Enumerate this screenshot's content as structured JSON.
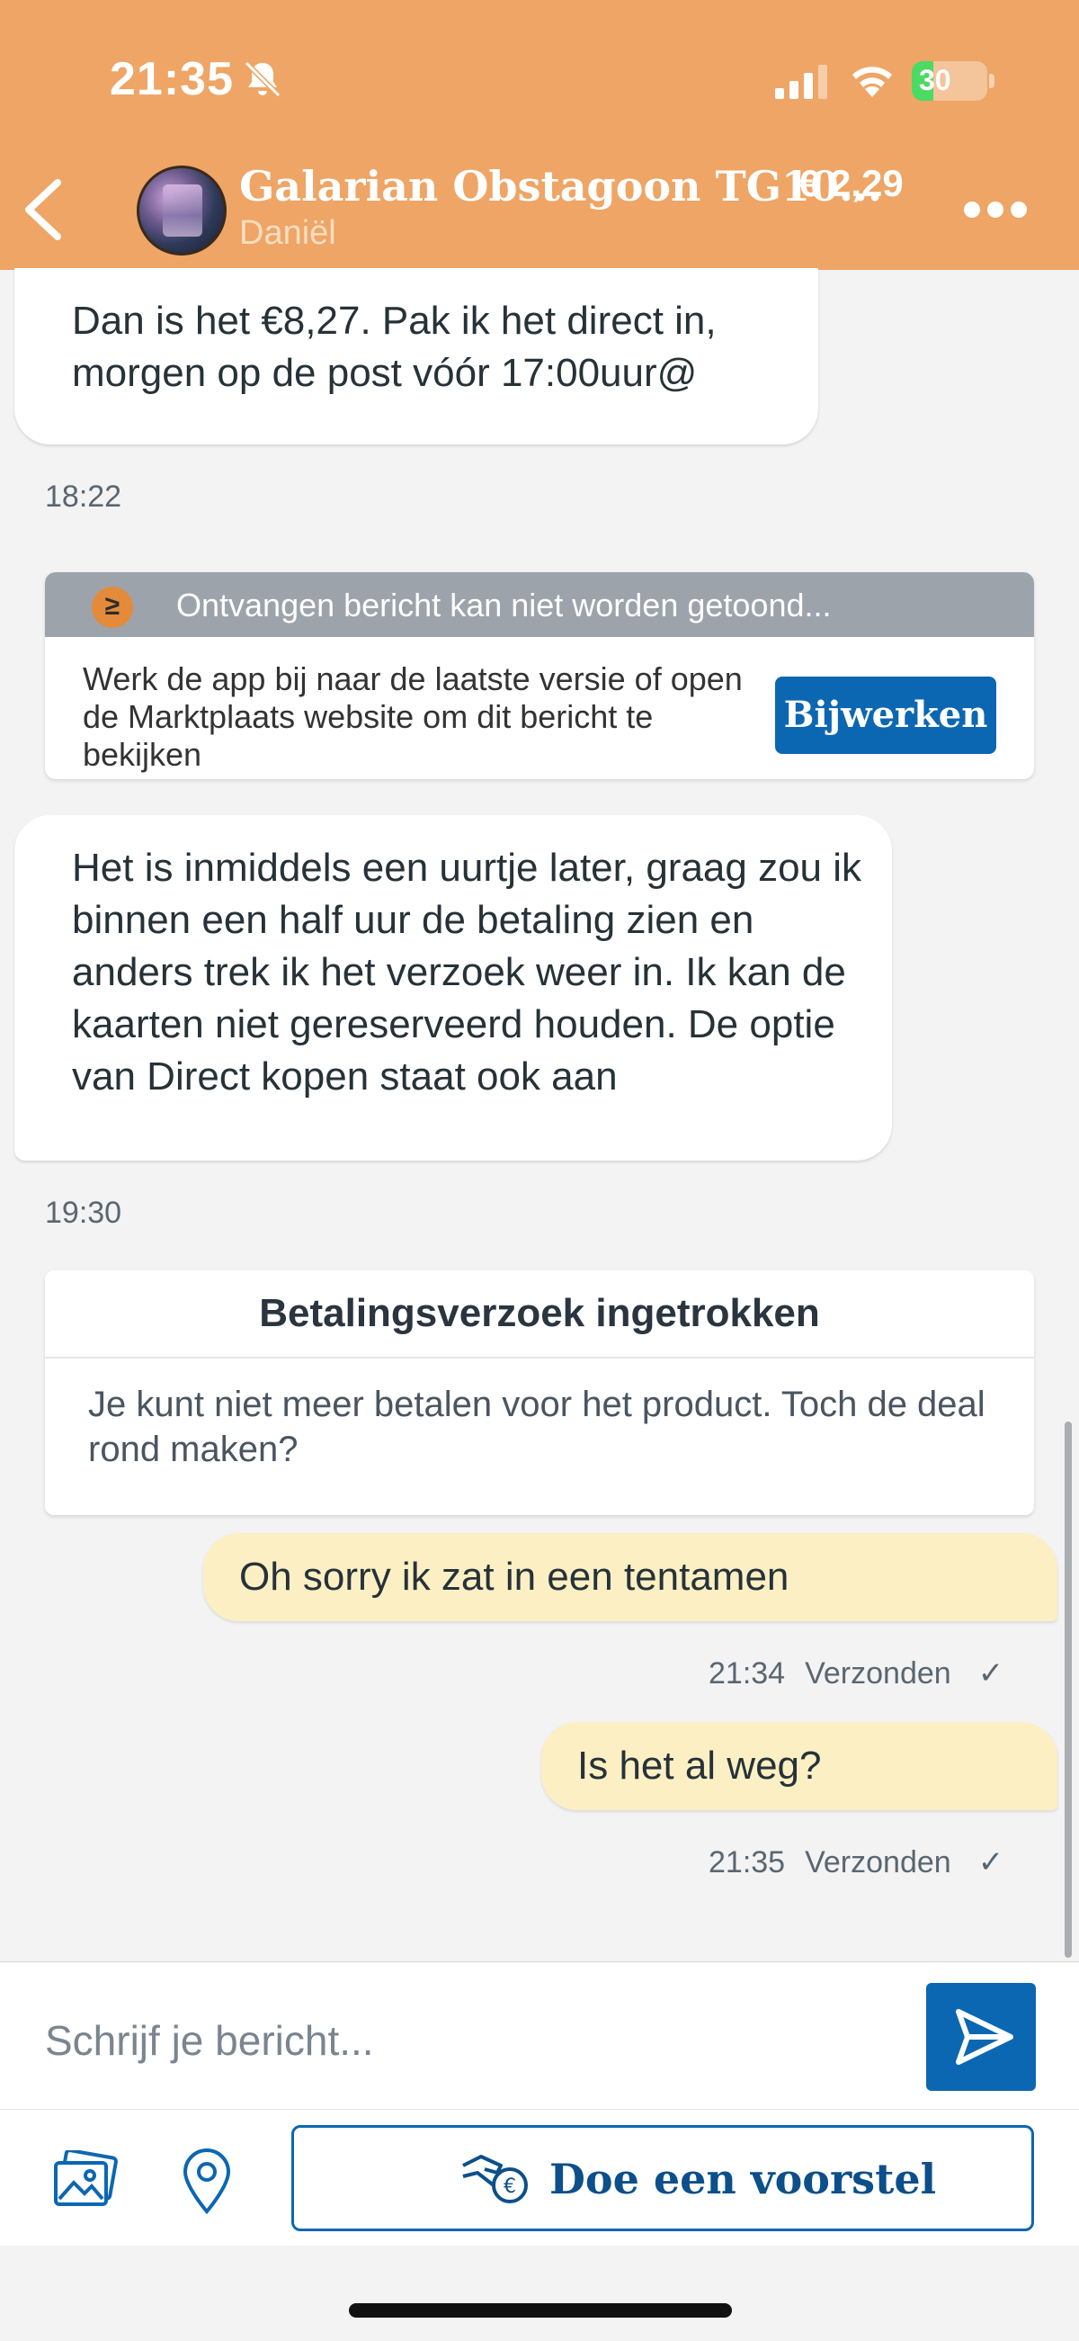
{
  "status_bar": {
    "time": "21:35",
    "battery": "30"
  },
  "header": {
    "title": "Galarian Obstagoon TG10...",
    "price": "€ 2,29",
    "seller": "Daniël"
  },
  "messages": [
    {
      "text": "Dan is het €8,27. Pak ik het direct in, morgen op de post vóór 17:00uur@"
    },
    {
      "time": "18:22"
    },
    {
      "notice_header": "Ontvangen bericht kan niet worden getoond...",
      "notice_body": "Werk de app bij naar de laatste versie of open de Marktplaats website om dit bericht te bekijken",
      "button": "Bijwerken"
    },
    {
      "text": "Het is inmiddels een uurtje later, graag zou ik binnen een half uur de betaling zien en anders trek ik het verzoek weer in. Ik kan de kaarten niet gereserveerd houden. De optie van Direct kopen staat ook aan"
    },
    {
      "time": "19:30"
    },
    {
      "card_title": "Betalingsverzoek ingetrokken",
      "card_body": "Je kunt niet meer betalen voor het product. Toch de deal rond maken?"
    },
    {
      "text": "Oh sorry ik zat in een tentamen",
      "time": "21:34",
      "status": "Verzonden",
      "check": "✓"
    },
    {
      "text": "Is het al weg?",
      "time": "21:35",
      "status": "Verzonden",
      "check": "✓"
    }
  ],
  "composer": {
    "placeholder": "Schrijf je bericht..."
  },
  "actions": {
    "offer_label": "Doe een voorstel"
  },
  "icons": [
    "bell-off-icon",
    "signal-icon",
    "wifi-icon",
    "back-icon",
    "more-icon",
    "send-icon",
    "image-icon",
    "location-icon",
    "offer-hand-icon"
  ],
  "colors": {
    "header": "#eea565",
    "primary": "#0c67b2",
    "outgoing_bubble": "#fcefc4"
  }
}
